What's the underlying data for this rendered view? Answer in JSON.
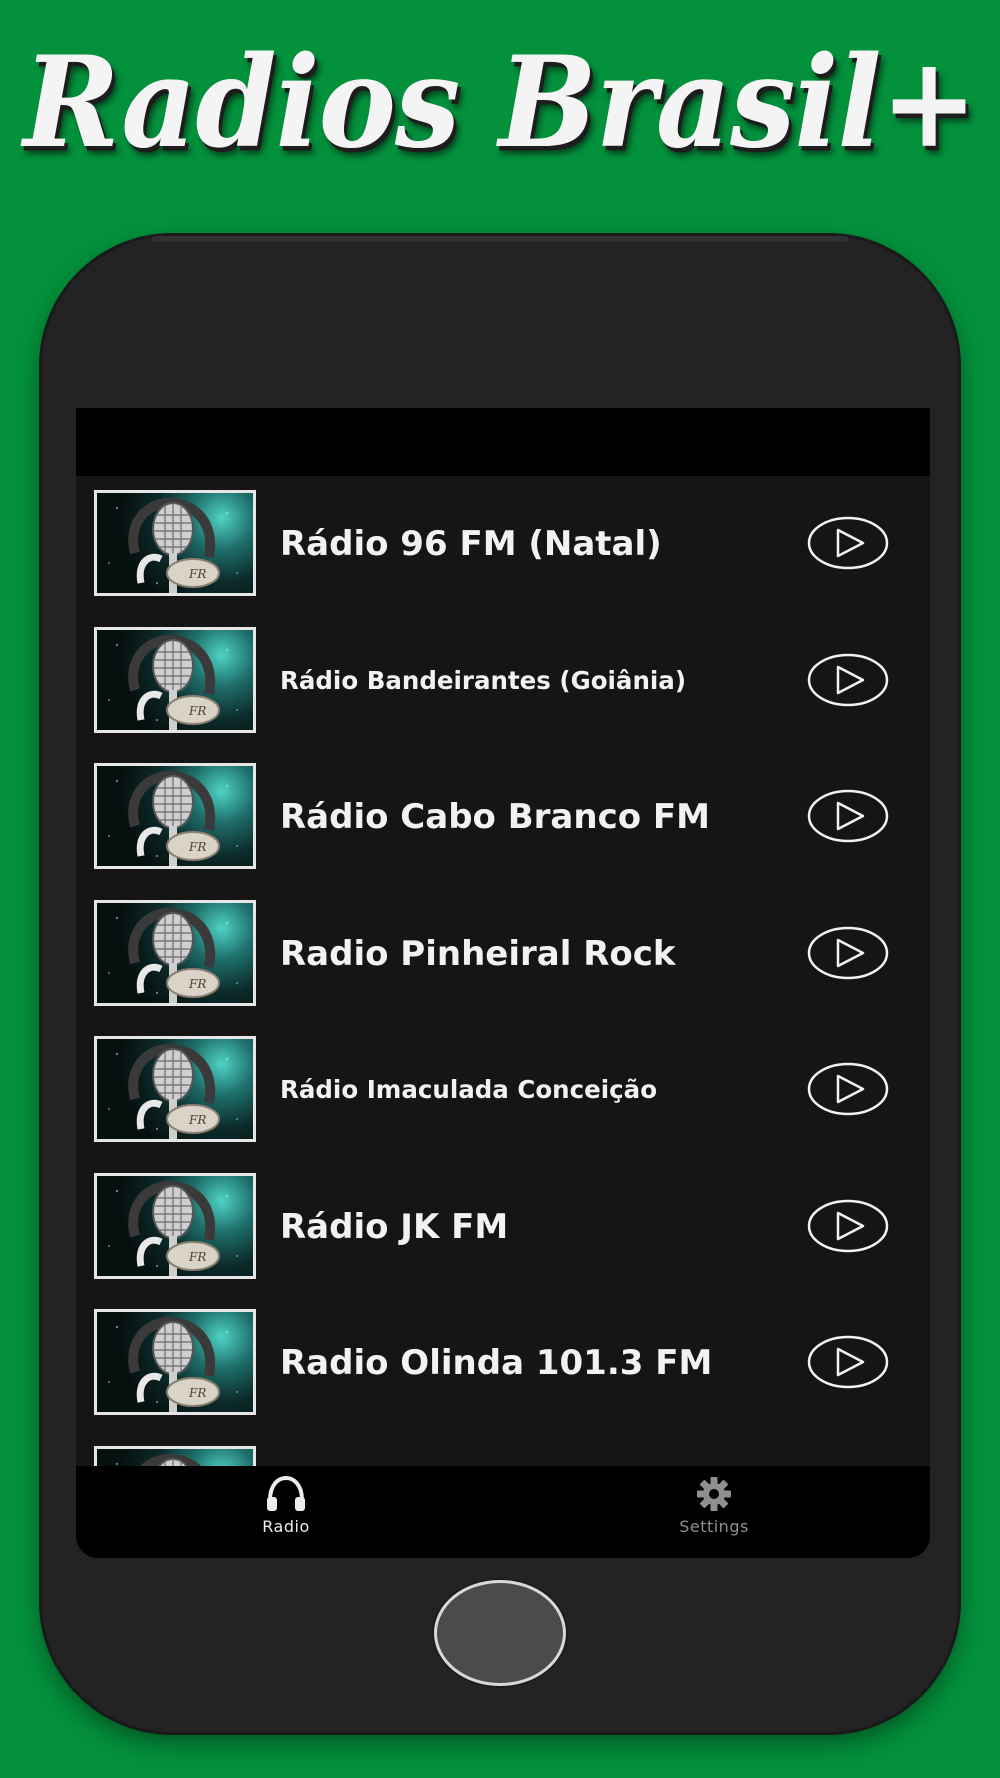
{
  "promo": {
    "title": "Radios Brasil+"
  },
  "colors": {
    "background": "#03913c",
    "phone_body": "#232323",
    "screen": "#151515",
    "header_bar": "#000000",
    "text_primary": "#f2f2f2",
    "nav_active": "#ececec",
    "nav_inactive": "#8f8f8f"
  },
  "stations": [
    {
      "name": "Rádio 96 FM (Natal)",
      "icon": "microphone-logo-icon",
      "action_icon": "play-icon"
    },
    {
      "name": "Rádio Bandeirantes (Goiânia)",
      "icon": "microphone-logo-icon",
      "action_icon": "play-icon"
    },
    {
      "name": "Rádio Cabo Branco FM",
      "icon": "microphone-logo-icon",
      "action_icon": "play-icon"
    },
    {
      "name": "Radio Pinheiral Rock",
      "icon": "microphone-logo-icon",
      "action_icon": "play-icon"
    },
    {
      "name": "Rádio Imaculada Conceição",
      "icon": "microphone-logo-icon",
      "action_icon": "play-icon"
    },
    {
      "name": "Rádio JK FM",
      "icon": "microphone-logo-icon",
      "action_icon": "play-icon"
    },
    {
      "name": "Radio Olinda 101.3 FM",
      "icon": "microphone-logo-icon",
      "action_icon": "play-icon"
    },
    {
      "name": "",
      "icon": "microphone-logo-icon",
      "action_icon": "play-icon"
    }
  ],
  "bottom_nav": {
    "items": [
      {
        "label": "Radio",
        "icon": "headphones-icon",
        "active": true
      },
      {
        "label": "Settings",
        "icon": "gear-icon",
        "active": false
      }
    ]
  }
}
